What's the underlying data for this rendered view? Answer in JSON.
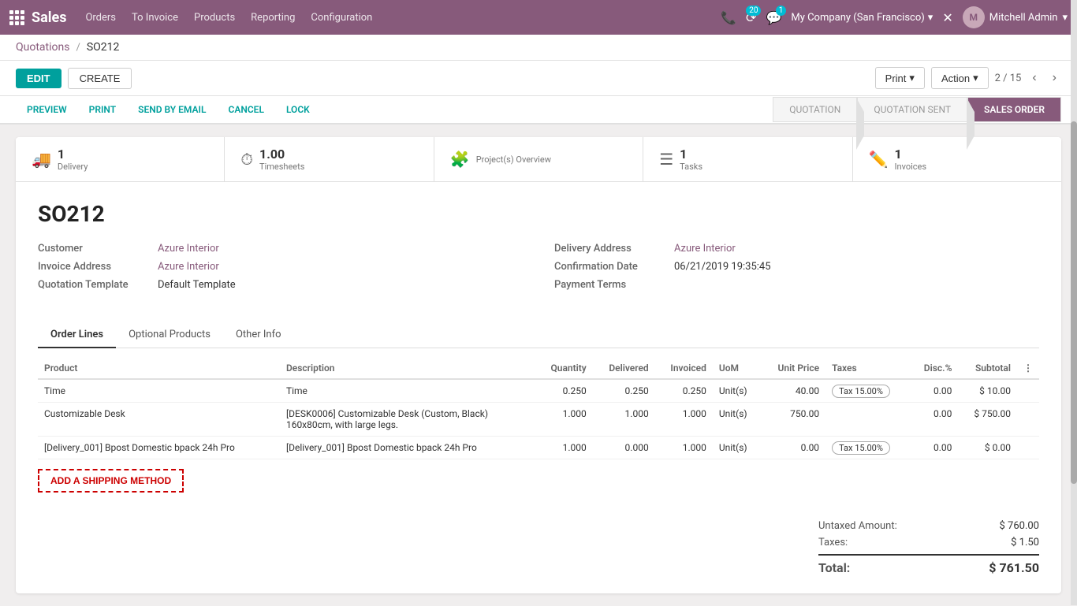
{
  "navbar": {
    "brand": "Sales",
    "links": [
      "Orders",
      "To Invoice",
      "Products",
      "Reporting",
      "Configuration"
    ],
    "notification_count": "20",
    "message_count": "1",
    "company": "My Company (San Francisco)",
    "user": "Mitchell Admin"
  },
  "breadcrumb": {
    "parent": "Quotations",
    "current": "SO212"
  },
  "toolbar": {
    "edit_label": "EDIT",
    "create_label": "CREATE",
    "print_label": "Print",
    "action_label": "Action",
    "pagination": "2 / 15"
  },
  "status_actions": {
    "preview": "PREVIEW",
    "print": "PRINT",
    "send_by_email": "SEND BY EMAIL",
    "cancel": "CANCEL",
    "lock": "LOCK"
  },
  "status_steps": {
    "quotation": "QUOTATION",
    "quotation_sent": "QUOTATION SENT",
    "sales_order": "SALES ORDER"
  },
  "stats": [
    {
      "icon": "🚚",
      "count": "1",
      "label": "Delivery"
    },
    {
      "icon": "⏱",
      "count": "1.00",
      "label": "Timesheets"
    },
    {
      "icon": "🧩",
      "count": "",
      "label": "Project(s) Overview"
    },
    {
      "icon": "☰",
      "count": "1",
      "label": "Tasks"
    },
    {
      "icon": "✏️",
      "count": "1",
      "label": "Invoices"
    }
  ],
  "form": {
    "title": "SO212",
    "customer_label": "Customer",
    "customer_value": "Azure Interior",
    "invoice_address_label": "Invoice Address",
    "invoice_address_value": "Azure Interior",
    "quotation_template_label": "Quotation Template",
    "quotation_template_value": "Default Template",
    "delivery_address_label": "Delivery Address",
    "delivery_address_value": "Azure Interior",
    "confirmation_date_label": "Confirmation Date",
    "confirmation_date_value": "06/21/2019 19:35:45",
    "payment_terms_label": "Payment Terms",
    "payment_terms_value": ""
  },
  "tabs": {
    "order_lines": "Order Lines",
    "optional_products": "Optional Products",
    "other_info": "Other Info"
  },
  "table": {
    "headers": [
      "Product",
      "Description",
      "Quantity",
      "Delivered",
      "Invoiced",
      "UoM",
      "Unit Price",
      "Taxes",
      "Disc.%",
      "Subtotal"
    ],
    "rows": [
      {
        "product": "Time",
        "description": "Time",
        "quantity": "0.250",
        "delivered": "0.250",
        "invoiced": "0.250",
        "uom": "Unit(s)",
        "unit_price": "40.00",
        "taxes": "Tax 15.00%",
        "disc": "0.00",
        "subtotal": "$ 10.00"
      },
      {
        "product": "Customizable Desk",
        "description": "[DESK0006] Customizable Desk (Custom, Black)\n160x80cm, with large legs.",
        "quantity": "1.000",
        "delivered": "1.000",
        "invoiced": "1.000",
        "uom": "Unit(s)",
        "unit_price": "750.00",
        "taxes": "",
        "disc": "0.00",
        "subtotal": "$ 750.00"
      },
      {
        "product": "[Delivery_001] Bpost Domestic bpack 24h Pro",
        "description": "[Delivery_001] Bpost Domestic bpack 24h Pro",
        "quantity": "1.000",
        "delivered": "0.000",
        "invoiced": "1.000",
        "uom": "Unit(s)",
        "unit_price": "0.00",
        "taxes": "Tax 15.00%",
        "disc": "0.00",
        "subtotal": "$ 0.00"
      }
    ]
  },
  "add_shipping_label": "ADD A SHIPPING METHOD",
  "totals": {
    "untaxed_label": "Untaxed Amount:",
    "untaxed_value": "$ 760.00",
    "taxes_label": "Taxes:",
    "taxes_value": "$ 1.50",
    "total_label": "Total:",
    "total_value": "$ 761.50"
  }
}
